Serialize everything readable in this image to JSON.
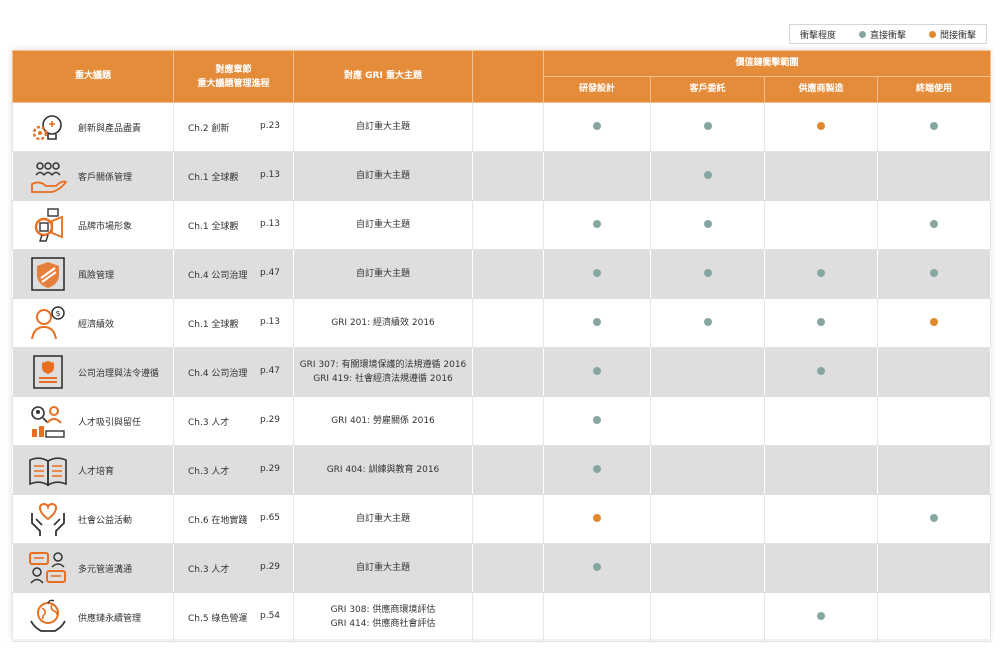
{
  "legend": {
    "title": "衝擊程度",
    "direct_label": "直接衝擊",
    "indirect_label": "間接衝擊",
    "direct_color": "#86a7a1",
    "indirect_color": "#e08a2c"
  },
  "header": {
    "topic": "重大議題",
    "chapter_line1": "對應章節",
    "chapter_line2": "重大議題管理進程",
    "gri": "對應 GRI 重大主題",
    "chain": "價值鏈衝擊範圍",
    "stages": [
      "研發設計",
      "客戶委託",
      "供應商製造",
      "終端使用"
    ]
  },
  "rows": [
    {
      "icon": "innovation-gear-icon",
      "topic": "創新與產品盡責",
      "chapter": "Ch.2 創新",
      "page": "p.23",
      "gri": [
        "自訂重大主題"
      ],
      "impacts": [
        "direct",
        "direct",
        "indirect",
        "direct"
      ]
    },
    {
      "icon": "customer-relations-icon",
      "topic": "客戶關係管理",
      "chapter": "Ch.1 全球觀",
      "page": "p.13",
      "gri": [
        "自訂重大主題"
      ],
      "impacts": [
        "",
        "direct",
        "",
        ""
      ]
    },
    {
      "icon": "brand-megaphone-icon",
      "topic": "品牌市場形象",
      "chapter": "Ch.1 全球觀",
      "page": "p.13",
      "gri": [
        "自訂重大主題"
      ],
      "impacts": [
        "direct",
        "direct",
        "",
        "direct"
      ]
    },
    {
      "icon": "shield-icon",
      "topic": "風險管理",
      "chapter": "Ch.4 公司治理",
      "page": "p.47",
      "gri": [
        "自訂重大主題"
      ],
      "impacts": [
        "direct",
        "direct",
        "direct",
        "direct"
      ]
    },
    {
      "icon": "economic-person-icon",
      "topic": "經濟績效",
      "chapter": "Ch.1 全球觀",
      "page": "p.13",
      "gri": [
        "GRI 201: 經濟績效 2016"
      ],
      "impacts": [
        "direct",
        "direct",
        "direct",
        "indirect"
      ]
    },
    {
      "icon": "certificate-icon",
      "topic": "公司治理與法令遵循",
      "chapter": "Ch.4 公司治理",
      "page": "p.47",
      "gri": [
        "GRI 307: 有關環境保護的法規遵循 2016",
        "GRI 419: 社會經濟法規遵循 2016"
      ],
      "impacts": [
        "direct",
        "",
        "direct",
        ""
      ]
    },
    {
      "icon": "talent-search-icon",
      "topic": "人才吸引與留任",
      "chapter": "Ch.3 人才",
      "page": "p.29",
      "gri": [
        "GRI 401: 勞雇關係 2016"
      ],
      "impacts": [
        "direct",
        "",
        "",
        ""
      ]
    },
    {
      "icon": "open-book-icon",
      "topic": "人才培育",
      "chapter": "Ch.3 人才",
      "page": "p.29",
      "gri": [
        "GRI 404: 訓練與教育 2016"
      ],
      "impacts": [
        "direct",
        "",
        "",
        ""
      ]
    },
    {
      "icon": "heart-hands-icon",
      "topic": "社會公益活動",
      "chapter": "Ch.6 在地實踐",
      "page": "p.65",
      "gri": [
        "自訂重大主題"
      ],
      "impacts": [
        "indirect",
        "",
        "",
        "direct"
      ]
    },
    {
      "icon": "chat-people-icon",
      "topic": "多元管道溝通",
      "chapter": "Ch.3 人才",
      "page": "p.29",
      "gri": [
        "自訂重大主題"
      ],
      "impacts": [
        "direct",
        "",
        "",
        ""
      ]
    },
    {
      "icon": "globe-hands-icon",
      "topic": "供應鏈永續管理",
      "chapter": "Ch.5 綠色營運",
      "page": "p.54",
      "gri": [
        "GRI 308: 供應商環境評估",
        "GRI 414: 供應商社會評估"
      ],
      "impacts": [
        "",
        "",
        "direct",
        ""
      ]
    }
  ]
}
